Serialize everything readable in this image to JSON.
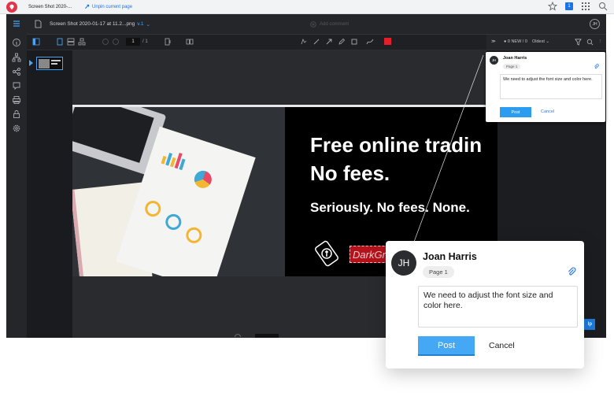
{
  "browser": {
    "tab_title": "Screen Shot 2020-...",
    "unpin_label": "Unpin current page",
    "notification_count": "1"
  },
  "app": {
    "filename": "Screen Shot 2020-01-17 at 11.2...png",
    "version": "v.1",
    "add_comment_placeholder": "Add comment",
    "user_initials": "JH",
    "page_input": "1",
    "page_total": "/ 1",
    "markup_color": "#e3202a"
  },
  "panel": {
    "filter_label": "0 NEW / 0",
    "sort_label": "Oldest"
  },
  "ad_image": {
    "headline_line1": "Free online tradin",
    "headline_line2": "No fees.",
    "subline": "Seriously. No fees. None.",
    "brand": "DarkGr"
  },
  "comment": {
    "author": "Joan Harris",
    "initials": "JH",
    "page_tag": "Page 1",
    "text": "We need to adjust the font size and color here.",
    "post_label": "Post",
    "cancel_label": "Cancel"
  },
  "help_label": "lp"
}
